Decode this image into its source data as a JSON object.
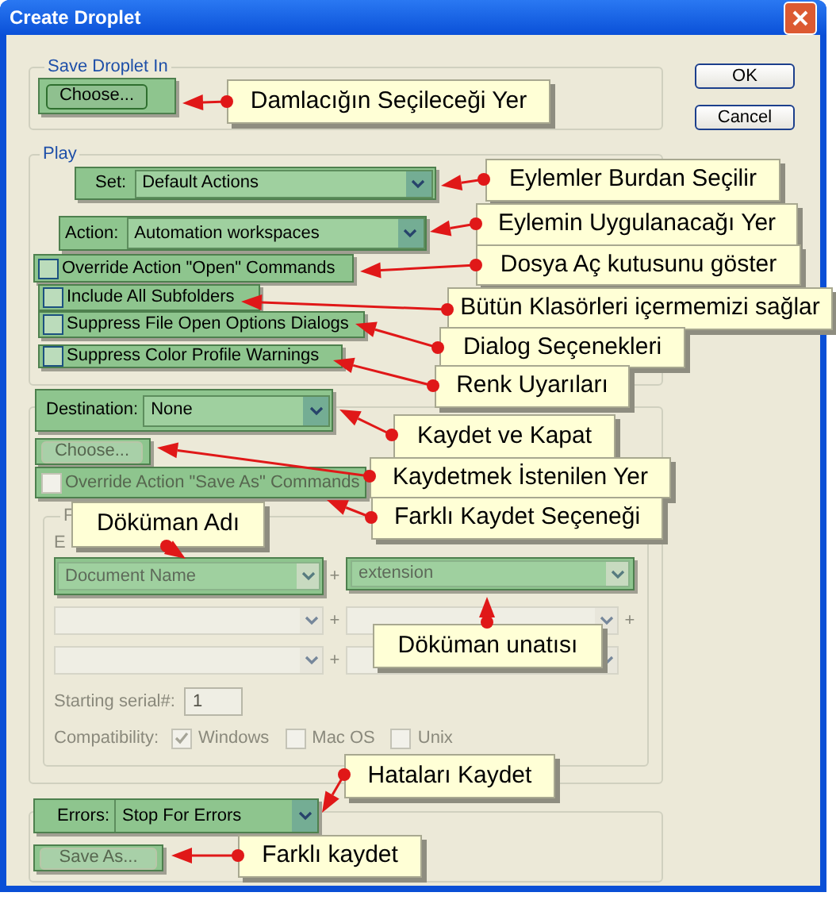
{
  "window": {
    "title": "Create Droplet"
  },
  "save_droplet_in": {
    "label": "Save Droplet In",
    "choose_button": "Choose..."
  },
  "buttons": [
    "OK",
    "Cancel"
  ],
  "play": {
    "label": "Play",
    "set": {
      "label": "Set:",
      "value": "Default Actions"
    },
    "action": {
      "label": "Action:",
      "value": "Automation workspaces"
    },
    "options": [
      {
        "label": "Override Action \"Open\" Commands",
        "checked": false
      },
      {
        "label": "Include All Subfolders",
        "checked": false
      },
      {
        "label": "Suppress File Open Options Dialogs",
        "checked": false
      },
      {
        "label": "Suppress Color Profile Warnings",
        "checked": false
      }
    ]
  },
  "destination": {
    "label": "Destination:",
    "value": "None",
    "choose_button": {
      "label": "Choose...",
      "disabled": true
    },
    "override_save_as": {
      "label": "Override Action \"Save As\" Commands",
      "checked": false,
      "disabled": true
    },
    "file_naming": {
      "label": "F",
      "example_label": "E",
      "disabled": true,
      "rows": [
        {
          "left": "Document Name",
          "plus": "+",
          "right": "extension"
        },
        {
          "plus": "+",
          "plus_end": "+"
        },
        {
          "plus": "+"
        }
      ],
      "starting_serial": {
        "label": "Starting serial#:",
        "value": "1"
      },
      "compatibility": {
        "label": "Compatibility:",
        "options": [
          {
            "label": "Windows",
            "checked": true
          },
          {
            "label": "Mac OS",
            "checked": false
          },
          {
            "label": "Unix",
            "checked": false
          }
        ]
      }
    }
  },
  "errors": {
    "label": "Errors:",
    "value": "Stop For Errors"
  },
  "save_as_button": {
    "label": "Save As...",
    "disabled": true
  },
  "callouts": [
    {
      "text": "Damlacığın Seçileceği Yer"
    },
    {
      "text": "Eylemler Burdan Seçilir"
    },
    {
      "text": "Eylemin Uygulanacağı Yer"
    },
    {
      "text": "Dosya Aç kutusunu göster"
    },
    {
      "text": "Bütün Klasörleri içermemizi sağlar"
    },
    {
      "text": "Dialog Seçenekleri"
    },
    {
      "text": "Renk Uyarıları"
    },
    {
      "text": "Kaydet ve Kapat"
    },
    {
      "text": "Kaydetmek İstenilen Yer"
    },
    {
      "text": "Döküman Adı"
    },
    {
      "text": "Farklı Kaydet Seçeneği"
    },
    {
      "text": "Döküman unatısı"
    },
    {
      "text": "Hataları Kaydet"
    },
    {
      "text": "Farklı kaydet"
    }
  ]
}
